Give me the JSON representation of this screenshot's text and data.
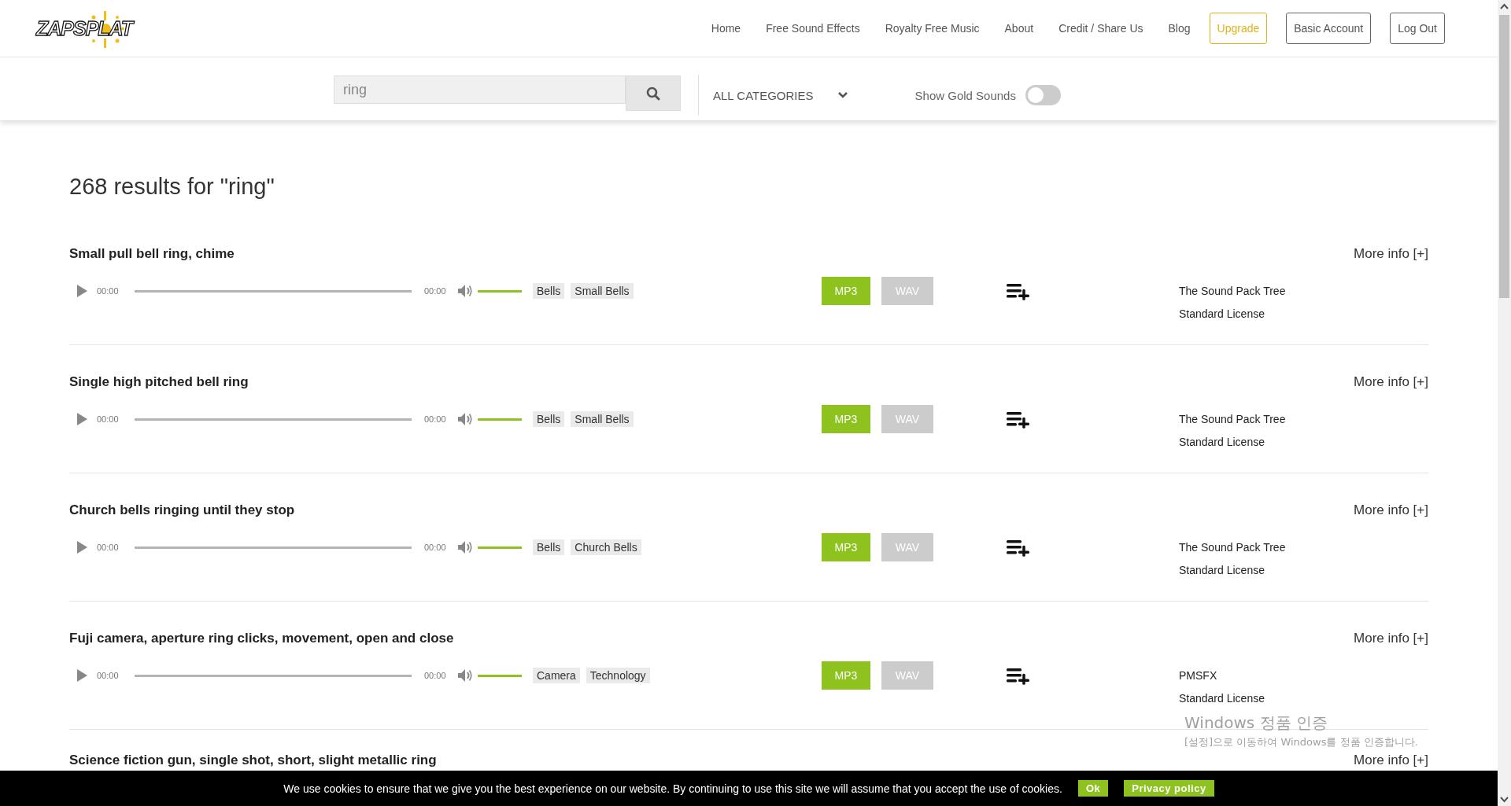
{
  "header": {
    "logo": "ZAPSPLAT",
    "nav": [
      {
        "label": "Home",
        "kind": "link"
      },
      {
        "label": "Free Sound Effects",
        "kind": "link"
      },
      {
        "label": "Royalty Free Music",
        "kind": "link"
      },
      {
        "label": "About",
        "kind": "link"
      },
      {
        "label": "Credit / Share Us",
        "kind": "link"
      },
      {
        "label": "Blog",
        "kind": "link"
      },
      {
        "label": "Upgrade",
        "kind": "highlight"
      },
      {
        "label": "Basic Account",
        "kind": "outline"
      },
      {
        "label": "Log Out",
        "kind": "outline"
      }
    ]
  },
  "search": {
    "value": "ring",
    "category": "ALL CATEGORIES",
    "gold_toggle": {
      "label": "Show Gold Sounds",
      "on": false
    }
  },
  "results_heading": "268 results for \"ring\"",
  "results": [
    {
      "title": "Small pull bell ring, chime",
      "current_time": "00:00",
      "duration": "00:00",
      "volume": {
        "level": 1
      },
      "tags": [
        "Bells",
        "Small Bells"
      ],
      "formats": [
        {
          "label": "MP3",
          "available": true
        },
        {
          "label": "WAV",
          "available": false
        }
      ],
      "author": "The Sound Pack Tree",
      "license": "Standard License",
      "more_info": "More info [+]"
    },
    {
      "title": "Single high pitched bell ring",
      "current_time": "00:00",
      "duration": "00:00",
      "volume": {
        "level": 1
      },
      "tags": [
        "Bells",
        "Small Bells"
      ],
      "formats": [
        {
          "label": "MP3",
          "available": true
        },
        {
          "label": "WAV",
          "available": false
        }
      ],
      "author": "The Sound Pack Tree",
      "license": "Standard License",
      "more_info": "More info [+]"
    },
    {
      "title": "Church bells ringing until they stop",
      "current_time": "00:00",
      "duration": "00:00",
      "volume": {
        "level": 1
      },
      "tags": [
        "Bells",
        "Church Bells"
      ],
      "formats": [
        {
          "label": "MP3",
          "available": true
        },
        {
          "label": "WAV",
          "available": false
        }
      ],
      "author": "The Sound Pack Tree",
      "license": "Standard License",
      "more_info": "More info [+]"
    },
    {
      "title": "Fuji camera, aperture ring clicks, movement, open and close",
      "current_time": "00:00",
      "duration": "00:00",
      "volume": {
        "level": 1
      },
      "tags": [
        "Camera",
        "Technology"
      ],
      "formats": [
        {
          "label": "MP3",
          "available": true
        },
        {
          "label": "WAV",
          "available": false
        }
      ],
      "author": "PMSFX",
      "license": "Standard License",
      "more_info": "More info [+]"
    },
    {
      "title": "Science fiction gun, single shot, short, slight metallic ring",
      "more_info": "More info [+]"
    }
  ],
  "cookie_bar": {
    "message": "We use cookies to ensure that we give you the best experience on our website. By continuing to use this site we will assume that you accept the use of cookies.",
    "buttons": [
      "Ok",
      "Privacy policy"
    ]
  },
  "os_notice": {
    "title": "Windows 정품 인증",
    "text": "[설정]으로 이동하여 Windows를 정품 인증합니다."
  }
}
